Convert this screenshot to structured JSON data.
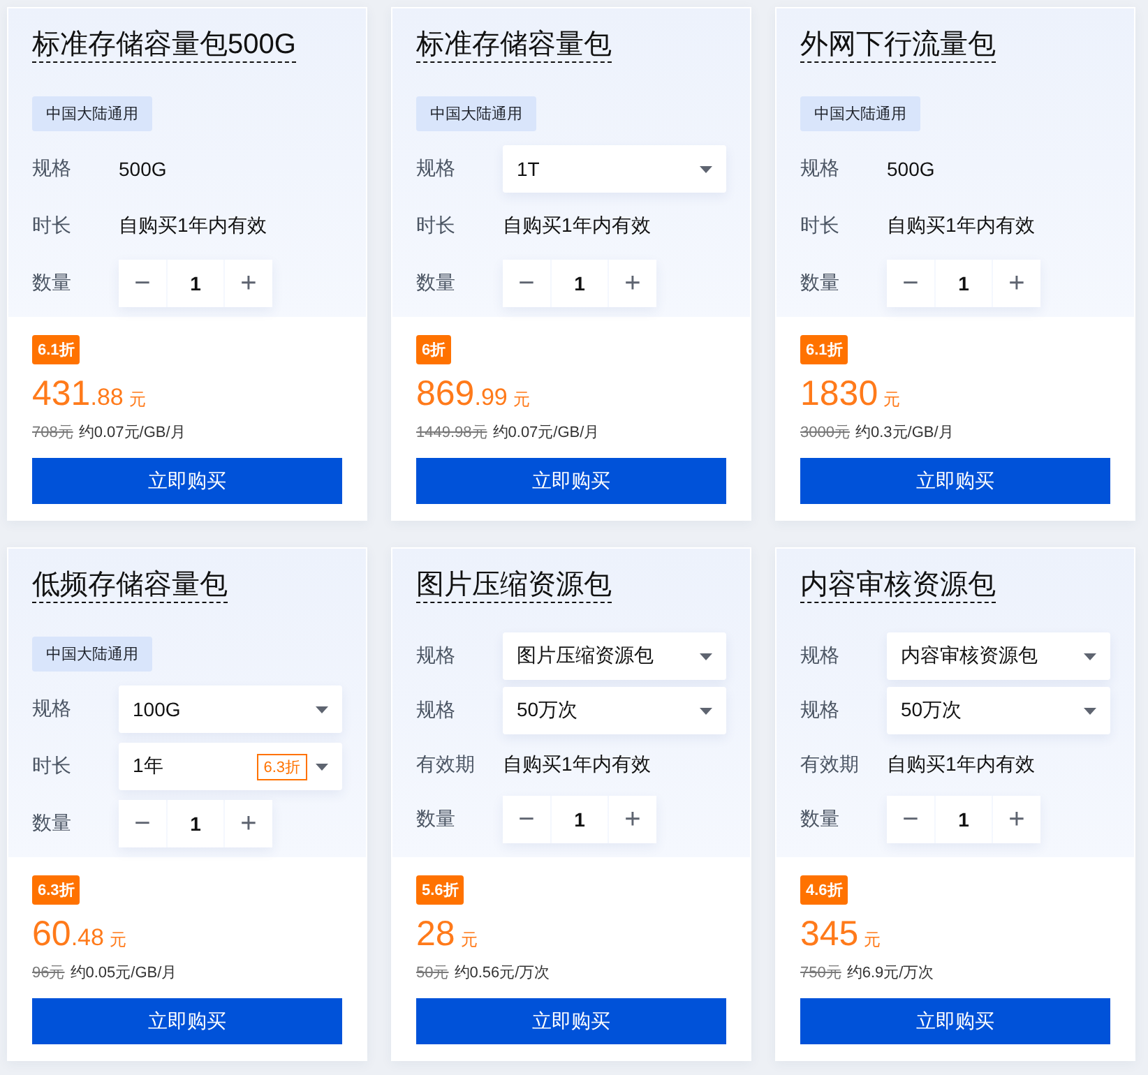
{
  "cards": [
    {
      "title": "标准存储容量包500G",
      "tag": "中国大陆通用",
      "rows": [
        {
          "kind": "text",
          "label": "规格",
          "value": "500G"
        },
        {
          "kind": "text",
          "label": "时长",
          "value": "自购买1年内有效"
        },
        {
          "kind": "stepper",
          "label": "数量",
          "minus": "−",
          "value": "1",
          "plus": "+"
        }
      ],
      "discount": "6.1折",
      "price": {
        "integer": "431",
        "decimal": ".88",
        "unit": "元"
      },
      "original_price": "708元",
      "unit_price": "约0.07元/GB/月",
      "button": "立即购买"
    },
    {
      "title": "标准存储容量包",
      "tag": "中国大陆通用",
      "rows": [
        {
          "kind": "select",
          "label": "规格",
          "value": "1T"
        },
        {
          "kind": "text",
          "label": "时长",
          "value": "自购买1年内有效"
        },
        {
          "kind": "stepper",
          "label": "数量",
          "minus": "−",
          "value": "1",
          "plus": "+"
        }
      ],
      "discount": "6折",
      "price": {
        "integer": "869",
        "decimal": ".99",
        "unit": "元"
      },
      "original_price": "1449.98元",
      "unit_price": "约0.07元/GB/月",
      "button": "立即购买"
    },
    {
      "title": "外网下行流量包",
      "tag": "中国大陆通用",
      "rows": [
        {
          "kind": "text",
          "label": "规格",
          "value": "500G"
        },
        {
          "kind": "text",
          "label": "时长",
          "value": "自购买1年内有效"
        },
        {
          "kind": "stepper",
          "label": "数量",
          "minus": "−",
          "value": "1",
          "plus": "+"
        }
      ],
      "discount": "6.1折",
      "price": {
        "integer": "1830",
        "unit": "元"
      },
      "original_price": "3000元",
      "unit_price": "约0.3元/GB/月",
      "button": "立即购买"
    },
    {
      "title": "低频存储容量包",
      "tag": "中国大陆通用",
      "rows": [
        {
          "kind": "select",
          "label": "规格",
          "value": "100G"
        },
        {
          "kind": "select",
          "label": "时长",
          "value": "1年",
          "badge": "6.3折"
        },
        {
          "kind": "stepper",
          "label": "数量",
          "minus": "−",
          "value": "1",
          "plus": "+"
        }
      ],
      "discount": "6.3折",
      "price": {
        "integer": "60",
        "decimal": ".48",
        "unit": "元"
      },
      "original_price": "96元",
      "unit_price": "约0.05元/GB/月",
      "button": "立即购买"
    },
    {
      "title": "图片压缩资源包",
      "rows": [
        {
          "kind": "select",
          "label": "规格",
          "value": "图片压缩资源包"
        },
        {
          "kind": "select",
          "label": "规格",
          "value": "50万次"
        },
        {
          "kind": "text",
          "label": "有效期",
          "value": "自购买1年内有效"
        },
        {
          "kind": "stepper",
          "label": "数量",
          "minus": "−",
          "value": "1",
          "plus": "+"
        }
      ],
      "discount": "5.6折",
      "price": {
        "integer": "28",
        "unit": "元"
      },
      "original_price": "50元",
      "unit_price": "约0.56元/万次",
      "button": "立即购买"
    },
    {
      "title": "内容审核资源包",
      "rows": [
        {
          "kind": "select",
          "label": "规格",
          "value": "内容审核资源包"
        },
        {
          "kind": "select",
          "label": "规格",
          "value": "50万次"
        },
        {
          "kind": "text",
          "label": "有效期",
          "value": "自购买1年内有效"
        },
        {
          "kind": "stepper",
          "label": "数量",
          "minus": "−",
          "value": "1",
          "plus": "+"
        }
      ],
      "discount": "4.6折",
      "price": {
        "integer": "345",
        "unit": "元"
      },
      "original_price": "750元",
      "unit_price": "约6.9元/万次",
      "button": "立即购买"
    }
  ]
}
